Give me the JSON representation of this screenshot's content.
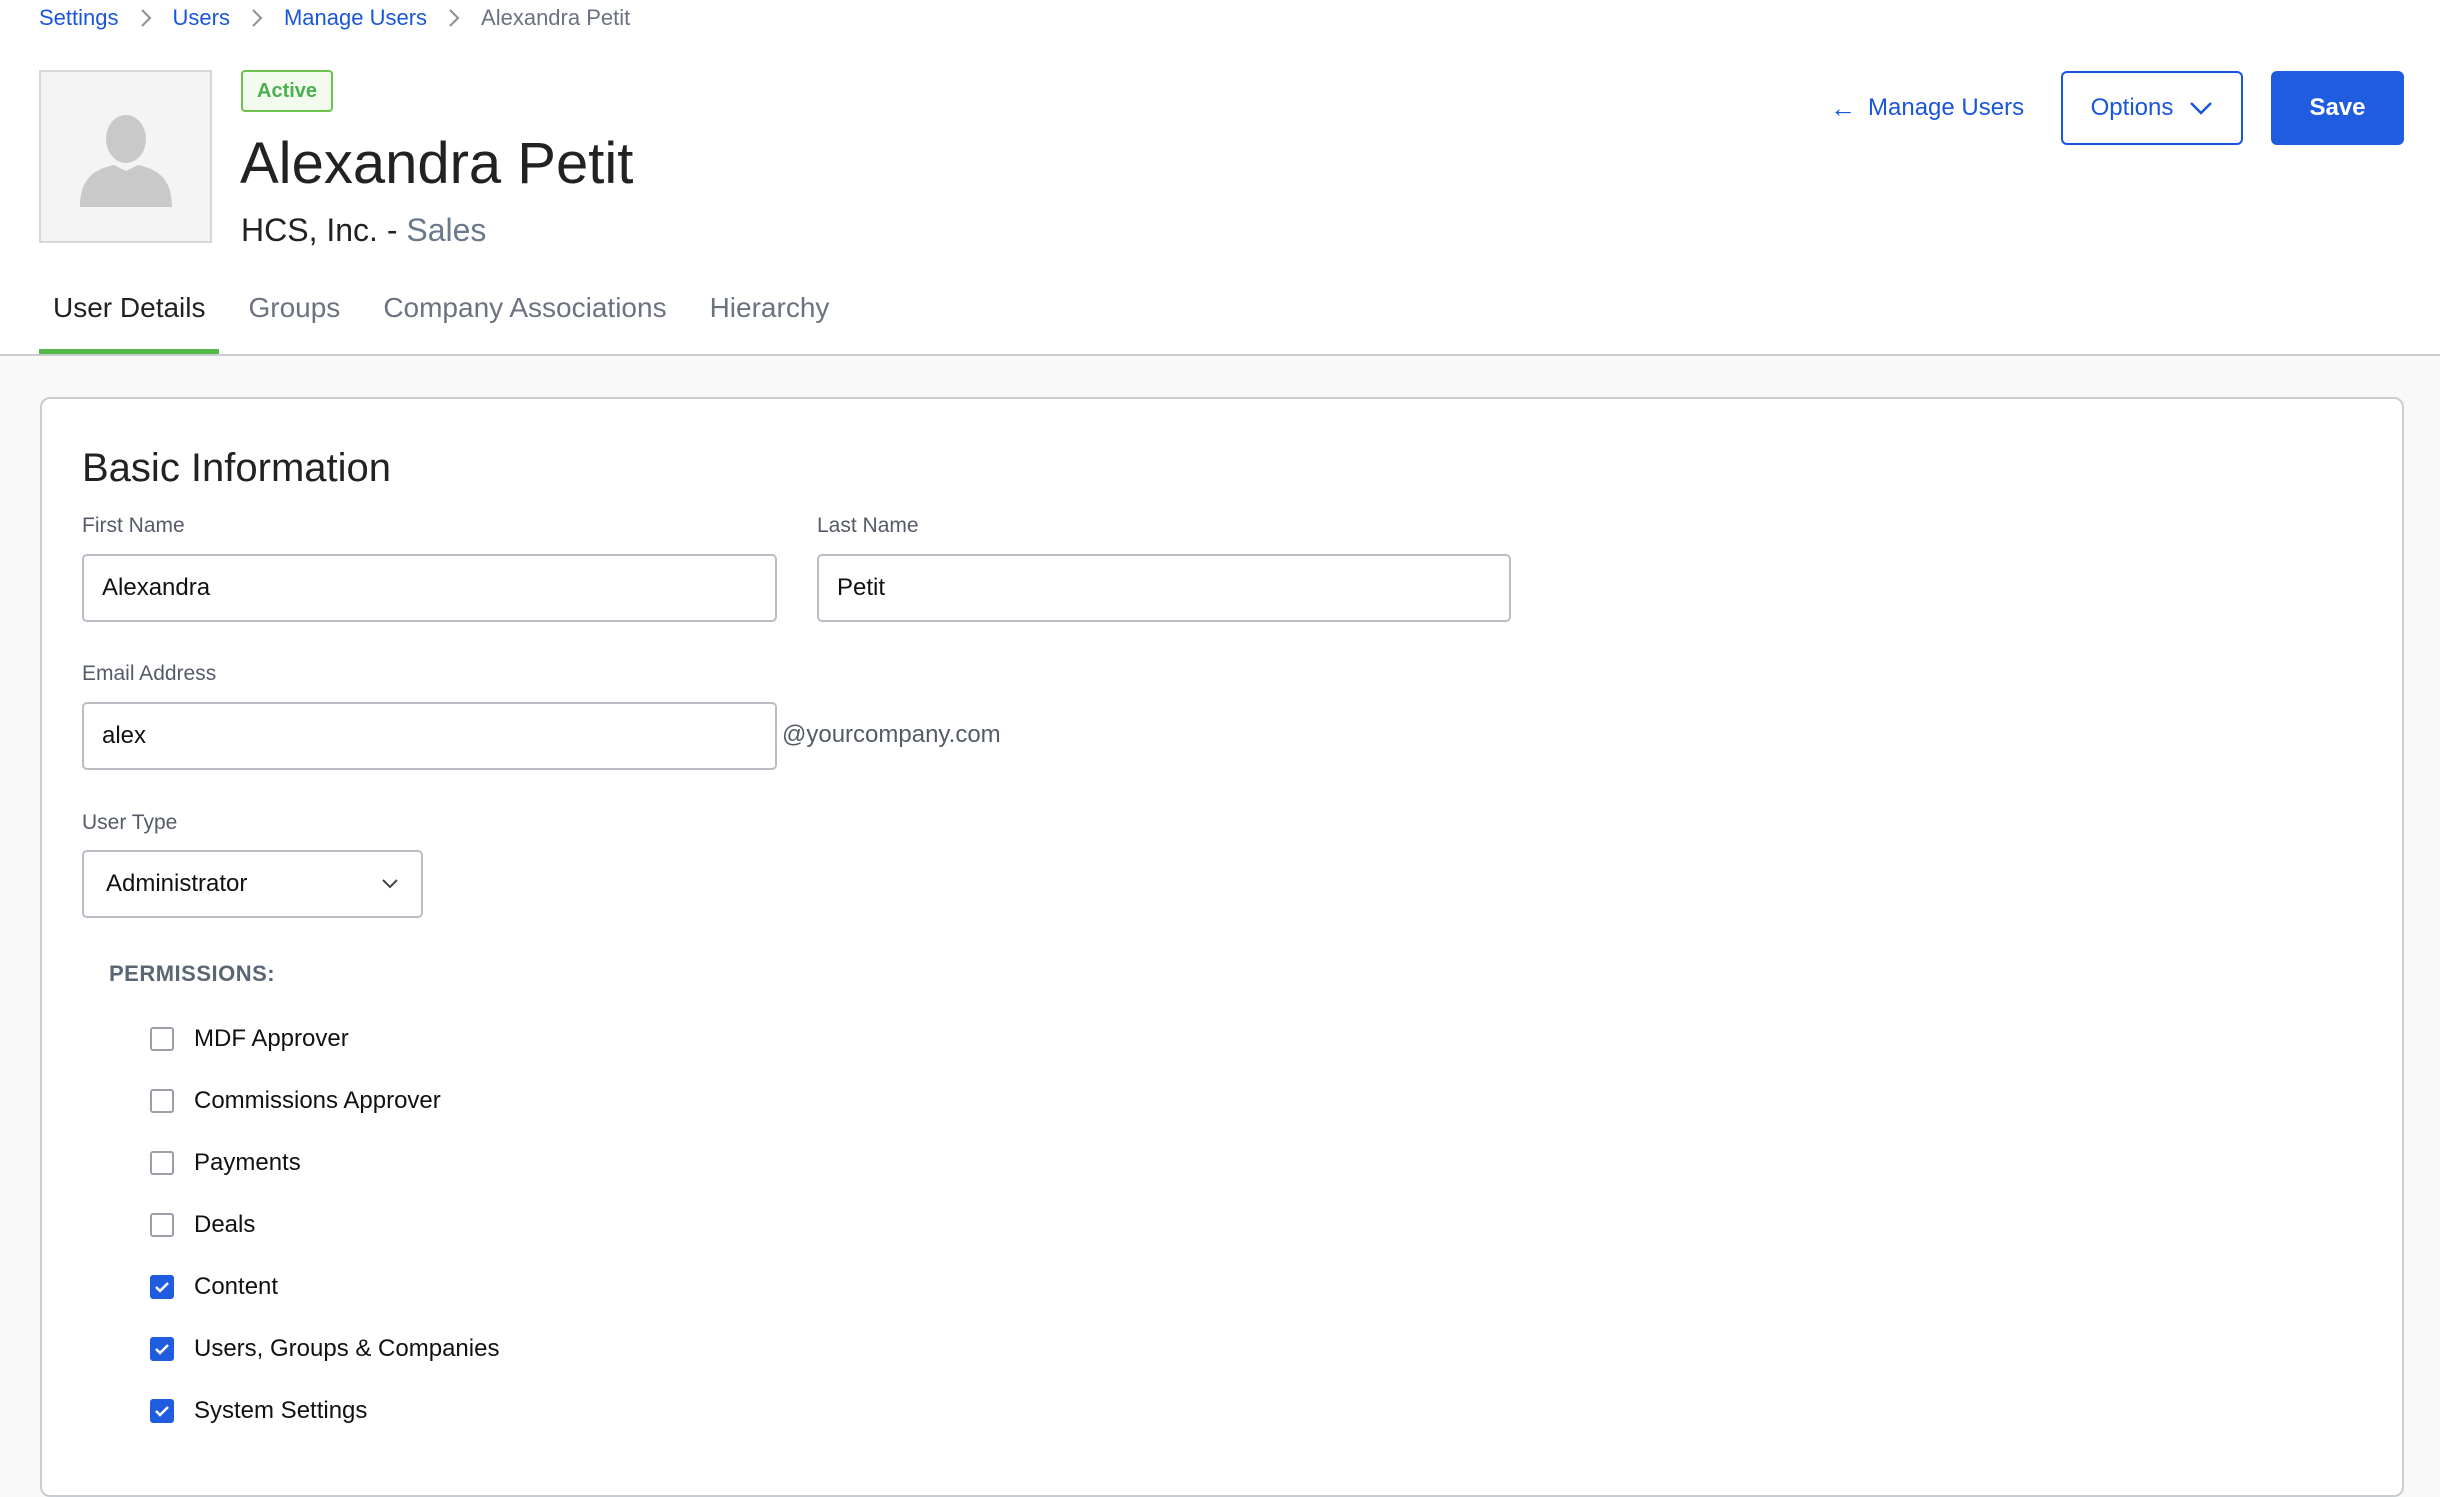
{
  "breadcrumb": {
    "items": [
      "Settings",
      "Users",
      "Manage Users"
    ],
    "current": "Alexandra Petit"
  },
  "profile": {
    "status": "Active",
    "name": "Alexandra Petit",
    "company": "HCS, Inc.",
    "separator": " - ",
    "department": "Sales"
  },
  "actions": {
    "back_label": "Manage Users",
    "options_label": "Options",
    "save_label": "Save"
  },
  "tabs": [
    {
      "label": "User Details",
      "active": true
    },
    {
      "label": "Groups",
      "active": false
    },
    {
      "label": "Company Associations",
      "active": false
    },
    {
      "label": "Hierarchy",
      "active": false
    }
  ],
  "form": {
    "section_title": "Basic Information",
    "first_name": {
      "label": "First Name",
      "value": "Alexandra"
    },
    "last_name": {
      "label": "Last Name",
      "value": "Petit"
    },
    "email": {
      "label": "Email Address",
      "value": "alex",
      "suffix": "@yourcompany.com"
    },
    "user_type": {
      "label": "User Type",
      "value": "Administrator"
    }
  },
  "permissions": {
    "title": "PERMISSIONS:",
    "items": [
      {
        "label": "MDF Approver",
        "checked": false
      },
      {
        "label": "Commissions Approver",
        "checked": false
      },
      {
        "label": "Payments",
        "checked": false
      },
      {
        "label": "Deals",
        "checked": false
      },
      {
        "label": "Content",
        "checked": true
      },
      {
        "label": "Users, Groups & Companies",
        "checked": true
      },
      {
        "label": "System Settings",
        "checked": true
      }
    ]
  },
  "colors": {
    "accent": "#1f5ce0",
    "link": "#1a56db",
    "active_tab": "#55b94a",
    "status": "#4caf50"
  }
}
